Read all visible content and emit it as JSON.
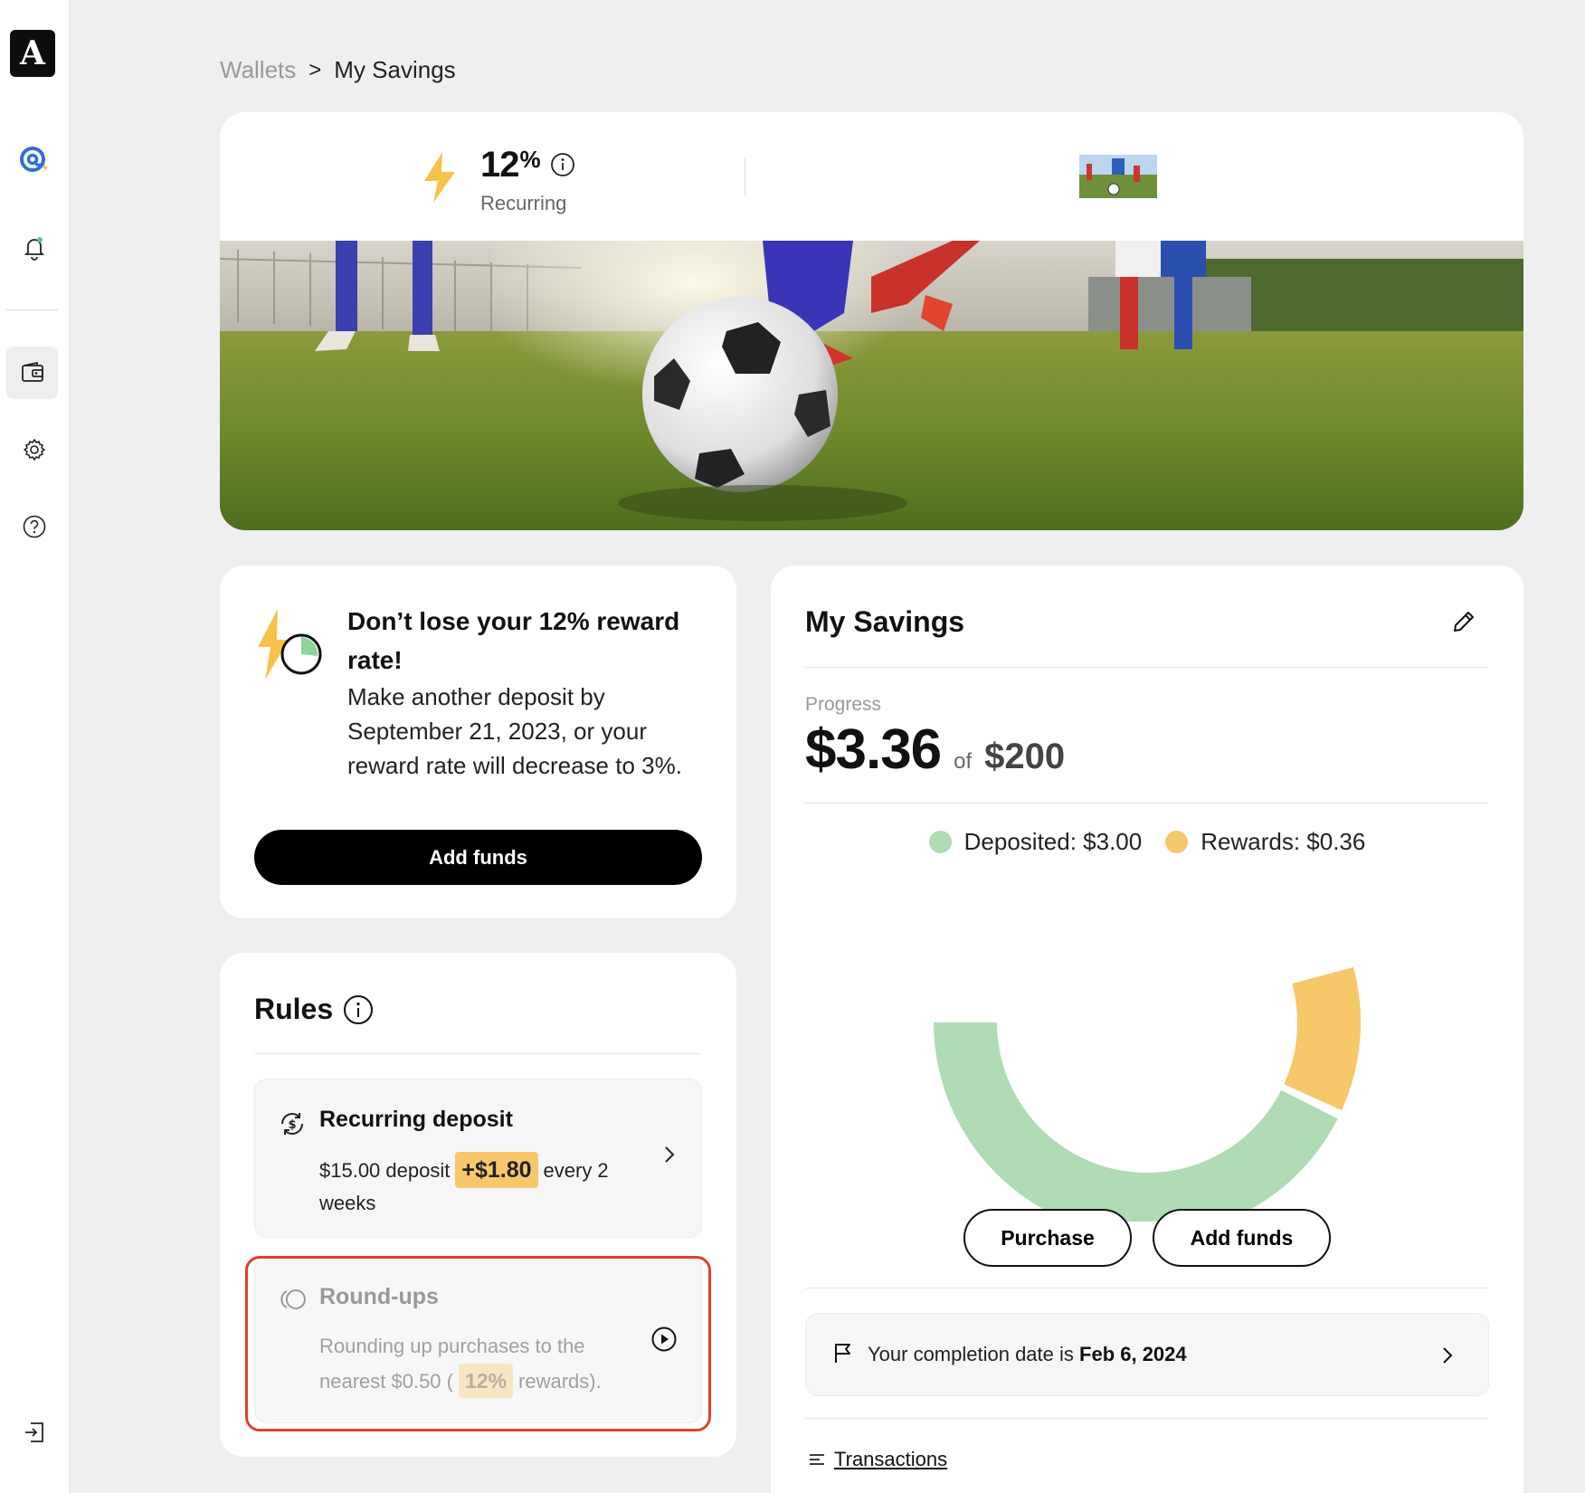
{
  "sidebar": {
    "logo_letter": "A",
    "items": [
      {
        "icon": "brand-at-icon",
        "label": ""
      },
      {
        "icon": "bell-icon",
        "label": ""
      },
      {
        "icon": "wallet-icon",
        "label": "",
        "active": true
      },
      {
        "icon": "gear-icon",
        "label": ""
      },
      {
        "icon": "help-icon",
        "label": ""
      },
      {
        "icon": "logout-icon",
        "label": ""
      }
    ]
  },
  "breadcrumb": {
    "parent": "Wallets",
    "separator": ">",
    "current": "My Savings"
  },
  "hero": {
    "rate_value": "12",
    "rate_unit": "%",
    "rate_label": "Recurring",
    "photo_icon": "soccer-photo"
  },
  "reward_card": {
    "title": "Don’t lose your 12% reward rate!",
    "body": "Make another deposit by September 21, 2023, or your reward rate will decrease to 3%.",
    "button": "Add funds"
  },
  "rules": {
    "title": "Rules",
    "recurring": {
      "name": "Recurring deposit",
      "desc_pre": "$15.00 deposit",
      "chip": "+$1.80",
      "desc_post": "every 2 weeks"
    },
    "roundups": {
      "name": "Round-ups",
      "desc_pre": "Rounding up purchases to the nearest $0.50 (",
      "chip": "12%",
      "desc_post": "rewards)."
    }
  },
  "savings": {
    "title": "My Savings",
    "progress_label": "Progress",
    "current": "$3.36",
    "of": "of",
    "goal": "$200",
    "legend": {
      "deposited": "Deposited: $3.00",
      "rewards": "Rewards: $0.36"
    },
    "deposited_value": 3.0,
    "rewards_value": 0.36,
    "colors": {
      "deposited": "#afdcb5",
      "rewards": "#f6c86a"
    },
    "purchase_button": "Purchase",
    "add_funds_button": "Add funds",
    "completion_pre": "Your completion date is",
    "completion_date": "Feb 6, 2024",
    "transactions": "Transactions"
  }
}
